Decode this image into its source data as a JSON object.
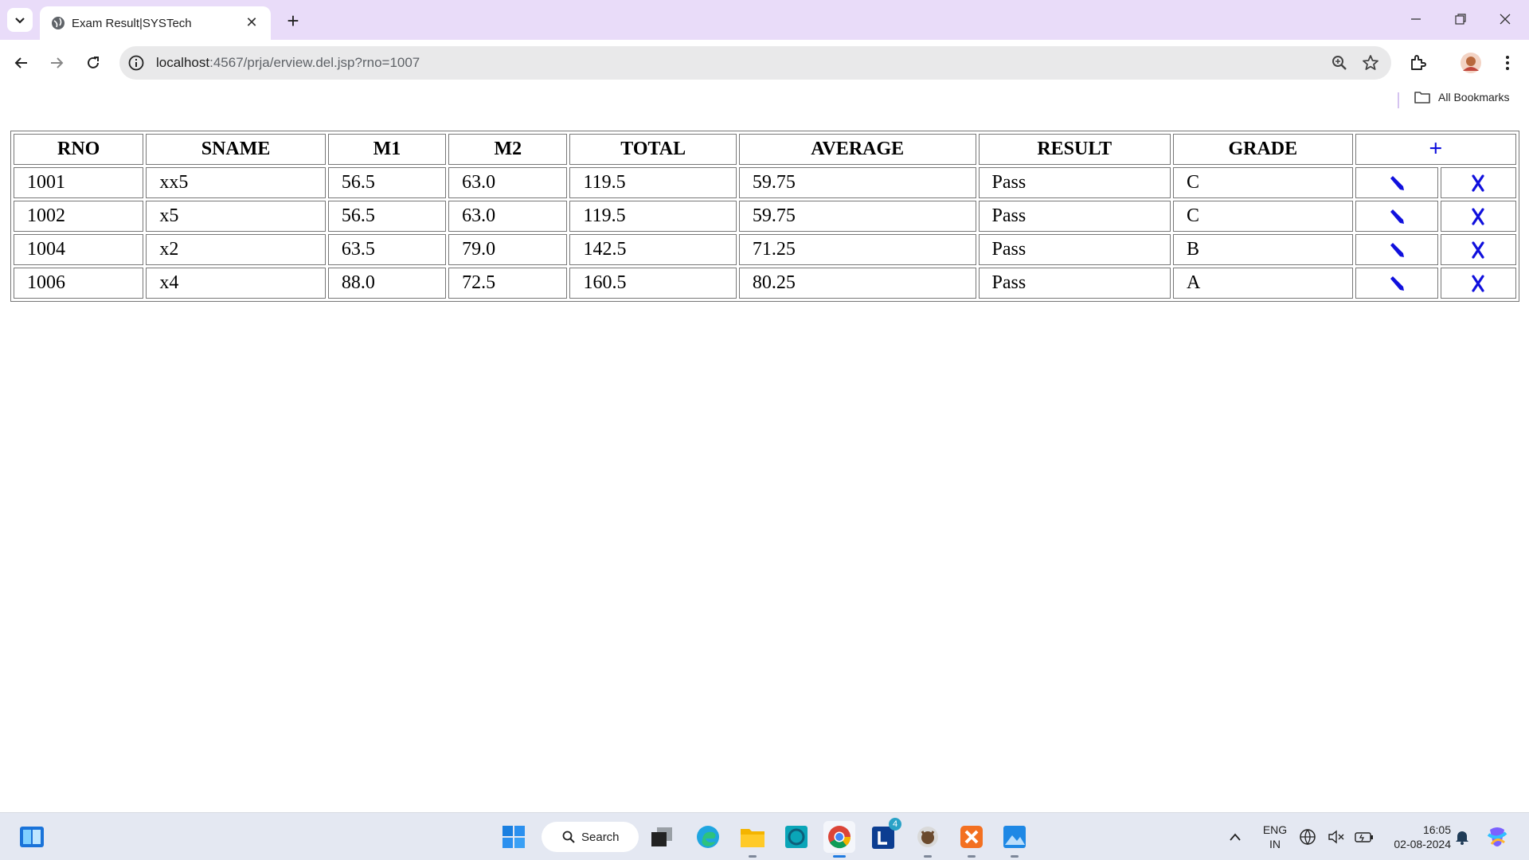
{
  "browser": {
    "tab_title": "Exam Result|SYSTech",
    "url_host": "localhost",
    "url_path": ":4567/prja/erview.del.jsp?rno=1007",
    "bookmarks_label": "All Bookmarks"
  },
  "table": {
    "headers": [
      "RNO",
      "SNAME",
      "M1",
      "M2",
      "TOTAL",
      "AVERAGE",
      "RESULT",
      "GRADE"
    ],
    "add_label": "+",
    "rows": [
      {
        "rno": "1001",
        "sname": "xx5",
        "m1": "56.5",
        "m2": "63.0",
        "total": "119.5",
        "average": "59.75",
        "result": "Pass",
        "grade": "C"
      },
      {
        "rno": "1002",
        "sname": "x5",
        "m1": "56.5",
        "m2": "63.0",
        "total": "119.5",
        "average": "59.75",
        "result": "Pass",
        "grade": "C"
      },
      {
        "rno": "1004",
        "sname": "x2",
        "m1": "63.5",
        "m2": "79.0",
        "total": "142.5",
        "average": "71.25",
        "result": "Pass",
        "grade": "B"
      },
      {
        "rno": "1006",
        "sname": "x4",
        "m1": "88.0",
        "m2": "72.5",
        "total": "160.5",
        "average": "80.25",
        "result": "Pass",
        "grade": "A"
      }
    ],
    "action_color": "#1010dd"
  },
  "taskbar": {
    "search_label": "Search",
    "lang_line1": "ENG",
    "lang_line2": "IN",
    "time": "16:05",
    "date": "02-08-2024",
    "badge_count": "4"
  },
  "icons": [
    "tab-list-icon",
    "globe-icon",
    "close-icon",
    "new-tab-icon",
    "minimize-icon",
    "restore-icon",
    "back-icon",
    "forward-icon",
    "reload-icon",
    "site-info-icon",
    "zoom-icon",
    "star-icon",
    "extensions-icon",
    "avatar",
    "menu-icon",
    "folder-icon",
    "add-icon",
    "edit-icon",
    "delete-icon"
  ]
}
